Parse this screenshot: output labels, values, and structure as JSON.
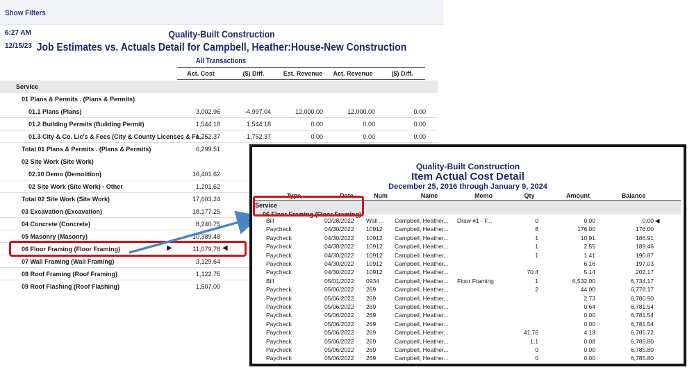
{
  "background_report": {
    "show_filters": "Show Filters",
    "time": "6:27 AM",
    "date": "12/15/23",
    "company": "Quality-Built Construction",
    "title": "Job Estimates vs. Actuals Detail for Campbell, Heather:House-New Construction",
    "subtitle": "All Transactions",
    "columns": [
      "Act. Cost",
      "($) Diff.",
      "Est. Revenue",
      "Act. Revenue",
      "($) Diff."
    ],
    "rows": [
      {
        "label": "Service",
        "values": [
          "",
          "",
          "",
          "",
          ""
        ]
      },
      {
        "label": "01 Plans & Permits  . (Plans & Permits)",
        "values": [
          "",
          "",
          "",
          "",
          ""
        ]
      },
      {
        "label": "01.1 Plans (Plans)",
        "values": [
          "3,002.96",
          "-4,997.04",
          "12,000.00",
          "12,000.00",
          "0.00"
        ]
      },
      {
        "label": "01.2 Building Permits (Building Permit)",
        "values": [
          "1,544.18",
          "1,544.18",
          "0.00",
          "0.00",
          "0.00"
        ]
      },
      {
        "label": "01.3 City & Co. Lic's & Fees (City & County Licenses & Fe...",
        "values": [
          "1,752.37",
          "1,752.37",
          "0.00",
          "0.00",
          "0.00"
        ]
      },
      {
        "label": "Total 01 Plans & Permits  . (Plans & Permits)",
        "values": [
          "6,299.51",
          "",
          "",
          "",
          ""
        ]
      },
      {
        "label": "02 Site Work (Site Work)",
        "values": [
          "",
          "",
          "",
          "",
          ""
        ]
      },
      {
        "label": "02.10 Demo (Demolition)",
        "values": [
          "16,401.62",
          "",
          "",
          "",
          ""
        ]
      },
      {
        "label": "02 Site Work (Site Work) - Other",
        "values": [
          "1,201.62",
          "",
          "",
          "",
          ""
        ]
      },
      {
        "label": "Total 02 Site Work (Site Work)",
        "values": [
          "17,603.24",
          "",
          "",
          "",
          ""
        ]
      },
      {
        "label": "03 Excavation (Excavation)",
        "values": [
          "18,177.25",
          "",
          "",
          "",
          ""
        ]
      },
      {
        "label": "04 Concrete (Concrete)",
        "values": [
          "8,240.75",
          "",
          "",
          "",
          ""
        ]
      },
      {
        "label": "05 Masonry (Masonry)",
        "values": [
          "10,389.48",
          "",
          "",
          "",
          ""
        ]
      },
      {
        "label": "06 Floor Framing (Floor Framing)",
        "values": [
          "11,079.78",
          "",
          "",
          "",
          ""
        ]
      },
      {
        "label": "07 Wall Framing (Wall Framing)",
        "values": [
          "3,129.64",
          "",
          "",
          "",
          ""
        ]
      },
      {
        "label": "08 Roof Framing (Roof Framing)",
        "values": [
          "1,122.75",
          "",
          "",
          "",
          ""
        ]
      },
      {
        "label": "09 Roof Flashing (Roof Flashing)",
        "values": [
          "1,507.00",
          "",
          "",
          "",
          ""
        ]
      }
    ]
  },
  "overlay_report": {
    "company": "Quality-Built Construction",
    "title": "Item Actual Cost Detail",
    "range": "December 25, 2016 through January 9, 2024",
    "columns": [
      "Type",
      "Date",
      "Num",
      "Name",
      "Memo",
      "Qty",
      "Amount",
      "Balance"
    ],
    "service_label": "Service",
    "floor_label": "06 Floor Framing (Floor Framing)",
    "rows": [
      {
        "type": "Bill",
        "date": "02/28/2022",
        "num": "Wall ...",
        "name": "Campbell, Heather...",
        "memo": "Draw #1 - F...",
        "qty": "0",
        "amount": "0.00",
        "balance": "0.00"
      },
      {
        "type": "Paycheck",
        "date": "04/30/2022",
        "num": "10912",
        "name": "Campbell, Heather...",
        "memo": "",
        "qty": "8",
        "amount": "176.00",
        "balance": "176.00"
      },
      {
        "type": "Paycheck",
        "date": "04/30/2022",
        "num": "10912",
        "name": "Campbell, Heather...",
        "memo": "",
        "qty": "1",
        "amount": "10.91",
        "balance": "186.91"
      },
      {
        "type": "Paycheck",
        "date": "04/30/2022",
        "num": "10912",
        "name": "Campbell, Heather...",
        "memo": "",
        "qty": "1",
        "amount": "2.55",
        "balance": "189.46"
      },
      {
        "type": "Paycheck",
        "date": "04/30/2022",
        "num": "10912",
        "name": "Campbell, Heather...",
        "memo": "",
        "qty": "1",
        "amount": "1.41",
        "balance": "190.87"
      },
      {
        "type": "Paycheck",
        "date": "04/30/2022",
        "num": "10912",
        "name": "Campbell, Heather...",
        "memo": "",
        "qty": "",
        "amount": "6.16",
        "balance": "197.03"
      },
      {
        "type": "Paycheck",
        "date": "04/30/2022",
        "num": "10912",
        "name": "Campbell, Heather...",
        "memo": "",
        "qty": "70.4",
        "amount": "5.14",
        "balance": "202.17"
      },
      {
        "type": "Bill",
        "date": "05/01/2022",
        "num": "0934",
        "name": "Campbell, Heather...",
        "memo": "Floor Framing",
        "qty": "1",
        "amount": "6,532.00",
        "balance": "6,734.17"
      },
      {
        "type": "Paycheck",
        "date": "05/06/2022",
        "num": "269",
        "name": "Campbell, Heather...",
        "memo": "",
        "qty": "2",
        "amount": "44.00",
        "balance": "6,778.17"
      },
      {
        "type": "Paycheck",
        "date": "05/06/2022",
        "num": "269",
        "name": "Campbell, Heather...",
        "memo": "",
        "qty": "",
        "amount": "2.73",
        "balance": "6,780.90"
      },
      {
        "type": "Paycheck",
        "date": "05/06/2022",
        "num": "269",
        "name": "Campbell, Heather...",
        "memo": "",
        "qty": "",
        "amount": "0.64",
        "balance": "6,781.54"
      },
      {
        "type": "Paycheck",
        "date": "05/06/2022",
        "num": "269",
        "name": "Campbell, Heather...",
        "memo": "",
        "qty": "",
        "amount": "0.00",
        "balance": "6,781.54"
      },
      {
        "type": "Paycheck",
        "date": "05/06/2022",
        "num": "269",
        "name": "Campbell, Heather...",
        "memo": "",
        "qty": "",
        "amount": "0.00",
        "balance": "6,781.54"
      },
      {
        "type": "Paycheck",
        "date": "05/06/2022",
        "num": "269",
        "name": "Campbell, Heather...",
        "memo": "",
        "qty": "41.76",
        "amount": "4.18",
        "balance": "6,785.72"
      },
      {
        "type": "Paycheck",
        "date": "05/06/2022",
        "num": "269",
        "name": "Campbell, Heather...",
        "memo": "",
        "qty": "1.1",
        "amount": "0.08",
        "balance": "6,785.80"
      },
      {
        "type": "Paycheck",
        "date": "05/06/2022",
        "num": "269",
        "name": "Campbell, Heather...",
        "memo": "",
        "qty": "0",
        "amount": "0.00",
        "balance": "6,785.80"
      },
      {
        "type": "Paycheck",
        "date": "05/06/2022",
        "num": "269",
        "name": "Campbell, Heather...",
        "memo": "",
        "qty": "0",
        "amount": "0.00",
        "balance": "6,785.80"
      }
    ]
  },
  "colors": {
    "title_blue": "#1b2a6b",
    "highlight_red": "#d3121b",
    "arrow_blue": "#4a86c5"
  }
}
